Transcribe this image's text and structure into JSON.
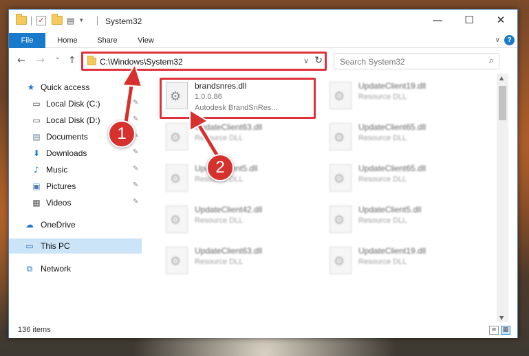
{
  "window": {
    "title": "System32",
    "controls": {
      "minimize": "—",
      "maximize": "☐",
      "close": "✕"
    }
  },
  "ribbon": {
    "tabs": [
      "File",
      "Home",
      "Share",
      "View"
    ],
    "collapse_glyph": "∨",
    "help_glyph": "?"
  },
  "navigation": {
    "back": "←",
    "forward": "→",
    "recent": "˅",
    "up": "↑",
    "address": "C:\\Windows\\System32",
    "address_dropdown": "∨",
    "refresh": "↻",
    "search_placeholder": "Search System32",
    "search_glyph": "⌕"
  },
  "sidebar": {
    "items": [
      {
        "label": "Quick access",
        "icon": "star-icon",
        "glyph": "★",
        "color": "#1979ca",
        "pinned": false,
        "selected": false
      },
      {
        "label": "Local Disk (C:)",
        "icon": "drive-icon",
        "glyph": "▭",
        "color": "#555555",
        "pinned": true,
        "selected": false
      },
      {
        "label": "Local Disk (D:)",
        "icon": "drive-icon",
        "glyph": "▭",
        "color": "#555555",
        "pinned": true,
        "selected": false
      },
      {
        "label": "Documents",
        "icon": "documents-icon",
        "glyph": "▤",
        "color": "#6b7f99",
        "pinned": true,
        "selected": false
      },
      {
        "label": "Downloads",
        "icon": "download-icon",
        "glyph": "⬇",
        "color": "#1979ca",
        "pinned": true,
        "selected": false
      },
      {
        "label": "Music",
        "icon": "music-icon",
        "glyph": "♪",
        "color": "#1979ca",
        "pinned": true,
        "selected": false
      },
      {
        "label": "Pictures",
        "icon": "pictures-icon",
        "glyph": "▣",
        "color": "#4a7fb5",
        "pinned": true,
        "selected": false
      },
      {
        "label": "Videos",
        "icon": "videos-icon",
        "glyph": "▦",
        "color": "#555555",
        "pinned": true,
        "selected": false
      },
      {
        "label": "OneDrive",
        "icon": "cloud-icon",
        "glyph": "☁",
        "color": "#1979ca",
        "pinned": false,
        "selected": false
      },
      {
        "label": "This PC",
        "icon": "computer-icon",
        "glyph": "▭",
        "color": "#1979ca",
        "pinned": false,
        "selected": true
      },
      {
        "label": "Network",
        "icon": "network-icon",
        "glyph": "⧉",
        "color": "#1979ca",
        "pinned": false,
        "selected": false
      }
    ],
    "pin_glyph": "✎"
  },
  "files": [
    {
      "name": "brandsnres.dll",
      "meta1": "1.0.0.86",
      "meta2": "Autodesk BrandSnRes...",
      "blurred": false
    },
    {
      "name": "UpdateClient19.dll",
      "meta1": "Resource DLL",
      "meta2": "",
      "blurred": true
    },
    {
      "name": "UpdateClient63.dll",
      "meta1": "Resource DLL",
      "meta2": "",
      "blurred": true
    },
    {
      "name": "UpdateClient65.dll",
      "meta1": "Resource DLL",
      "meta2": "",
      "blurred": true
    },
    {
      "name": "UpdateClient5.dll",
      "meta1": "Resource DLL",
      "meta2": "",
      "blurred": true
    },
    {
      "name": "UpdateClient65.dll",
      "meta1": "Resource DLL",
      "meta2": "",
      "blurred": true
    },
    {
      "name": "UpdateClient42.dll",
      "meta1": "Resource DLL",
      "meta2": "",
      "blurred": true
    },
    {
      "name": "UpdateClient5.dll",
      "meta1": "Resource DLL",
      "meta2": "",
      "blurred": true
    },
    {
      "name": "UpdateClient63.dll",
      "meta1": "Resource DLL",
      "meta2": "",
      "blurred": true
    },
    {
      "name": "UpdateClient19.dll",
      "meta1": "Resource DLL",
      "meta2": "",
      "blurred": true
    }
  ],
  "status": {
    "item_count": "136 items"
  },
  "annotations": {
    "badge1": "1",
    "badge2": "2",
    "highlight_color": "#e0303a",
    "badge_color": "#d7312e"
  },
  "colors": {
    "accent": "#1979ca",
    "selection": "#cce4f7"
  }
}
